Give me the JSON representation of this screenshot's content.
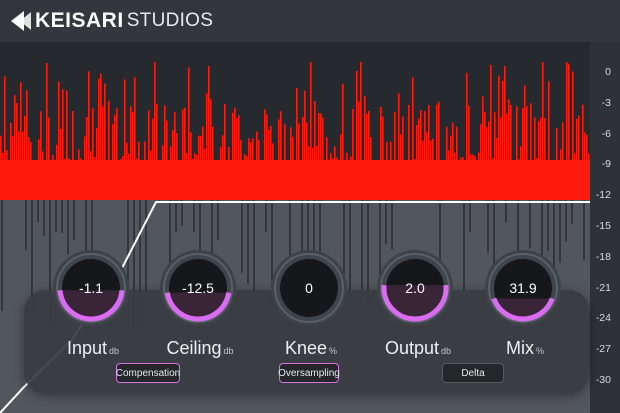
{
  "brand": {
    "name": "KEISARI",
    "suffix": "STUDIOS",
    "logo_icon": "k-triangle-logo-icon"
  },
  "colors": {
    "background": "#2c2f35",
    "waveform": "#ff1a0e",
    "threshold_line": "#ffffff",
    "accent": "#d96cf0",
    "knob_fill": "#3a2538"
  },
  "meter_scale": [
    "0",
    "-3",
    "-6",
    "-9",
    "-12",
    "-15",
    "-18",
    "-21",
    "-24",
    "-27",
    "-30"
  ],
  "threshold_db": -12,
  "knobs": [
    {
      "id": "input",
      "label": "Input",
      "unit": "db",
      "value": "-1.1",
      "fill": 0.46
    },
    {
      "id": "ceiling",
      "label": "Ceiling",
      "unit": "db",
      "value": "-12.5",
      "fill": 0.42
    },
    {
      "id": "knee",
      "label": "Knee",
      "unit": "%",
      "value": "0",
      "fill": 0
    },
    {
      "id": "output",
      "label": "Output",
      "unit": "db",
      "value": "2.0",
      "fill": 0.55
    },
    {
      "id": "mix",
      "label": "Mix",
      "unit": "%",
      "value": "31.9",
      "fill": 0.32
    }
  ],
  "buttons": [
    {
      "id": "compensation",
      "label": "Compensation",
      "active": true
    },
    {
      "id": "oversampling",
      "label": "Oversampling",
      "active": true
    },
    {
      "id": "delta",
      "label": "Delta",
      "active": false
    }
  ]
}
